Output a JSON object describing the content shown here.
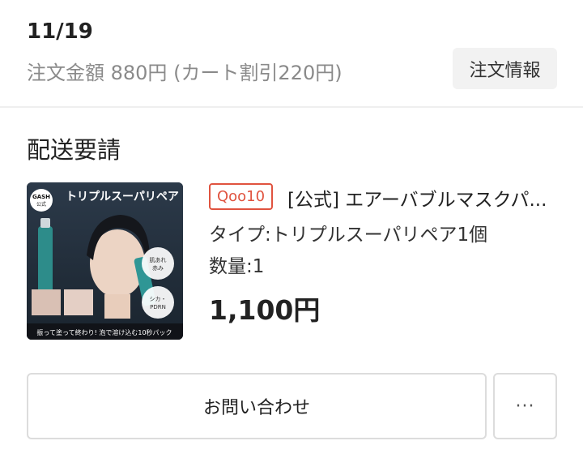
{
  "order": {
    "date": "11/19",
    "summary": "注文金額 880円 (カート割引220円)",
    "info_button_label": "注文情報"
  },
  "section": {
    "title": "配送要請"
  },
  "product": {
    "shop_badge": "Qoo10",
    "name": "[公式] エアーバブルマスクパ...",
    "type": "タイプ:トリプルスーパリペア1個",
    "quantity": "数量:1",
    "price": "1,100円",
    "image": {
      "logo": "GASH",
      "official": "公式",
      "headline": "トリプルスーパリペア",
      "bubble_1a": "肌あれ",
      "bubble_1b": "赤み",
      "bubble_2a": "シカ・",
      "bubble_2b": "PDRN",
      "footer": "振って塗って終わり! 泡で溶け込む10秒パック"
    }
  },
  "actions": {
    "inquiry_label": "お問い合わせ",
    "more_label": "···"
  }
}
